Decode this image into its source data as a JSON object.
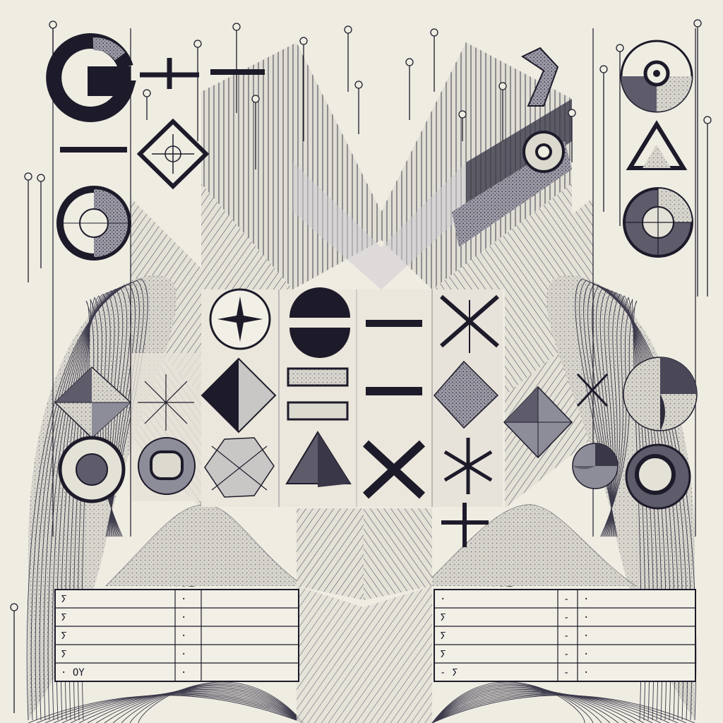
{
  "colors": {
    "paper": "#efece2",
    "ink": "#1d1b2a",
    "mid_gray": "#8d8c99",
    "light_gray": "#c9c7c6",
    "pale_panel": "#ebe7dc",
    "shadow_gray": "#5e5c6b"
  },
  "icons": [
    "g-glyph-icon",
    "plus-icon",
    "minus-icon",
    "diamond-cross-icon",
    "half-circle-icon",
    "segmented-target-icon",
    "triangle-icon",
    "split-ring-icon",
    "compass-star-icon",
    "split-circle-icon",
    "x-mark-icon",
    "asterisk-icon",
    "pyramid-icon",
    "octagon-cross-icon",
    "equals-bar-icon",
    "ring-icon",
    "fan-circle-icon"
  ],
  "tables": {
    "left": {
      "rows": [
        [
          "ⵢ",
          "·",
          ""
        ],
        [
          "ⵢ",
          "·",
          ""
        ],
        [
          "ⵢ",
          "·",
          ""
        ],
        [
          "ⵢ",
          "·",
          ""
        ],
        [
          "· OY",
          "·",
          ""
        ]
      ]
    },
    "right": {
      "rows": [
        [
          "·",
          "-",
          "·"
        ],
        [
          "ⵢ",
          "-",
          "·"
        ],
        [
          "ⵢ",
          "-",
          "·"
        ],
        [
          "ⵢ",
          "-",
          "·"
        ],
        [
          "- ⵢ",
          "-",
          "·"
        ]
      ]
    }
  }
}
